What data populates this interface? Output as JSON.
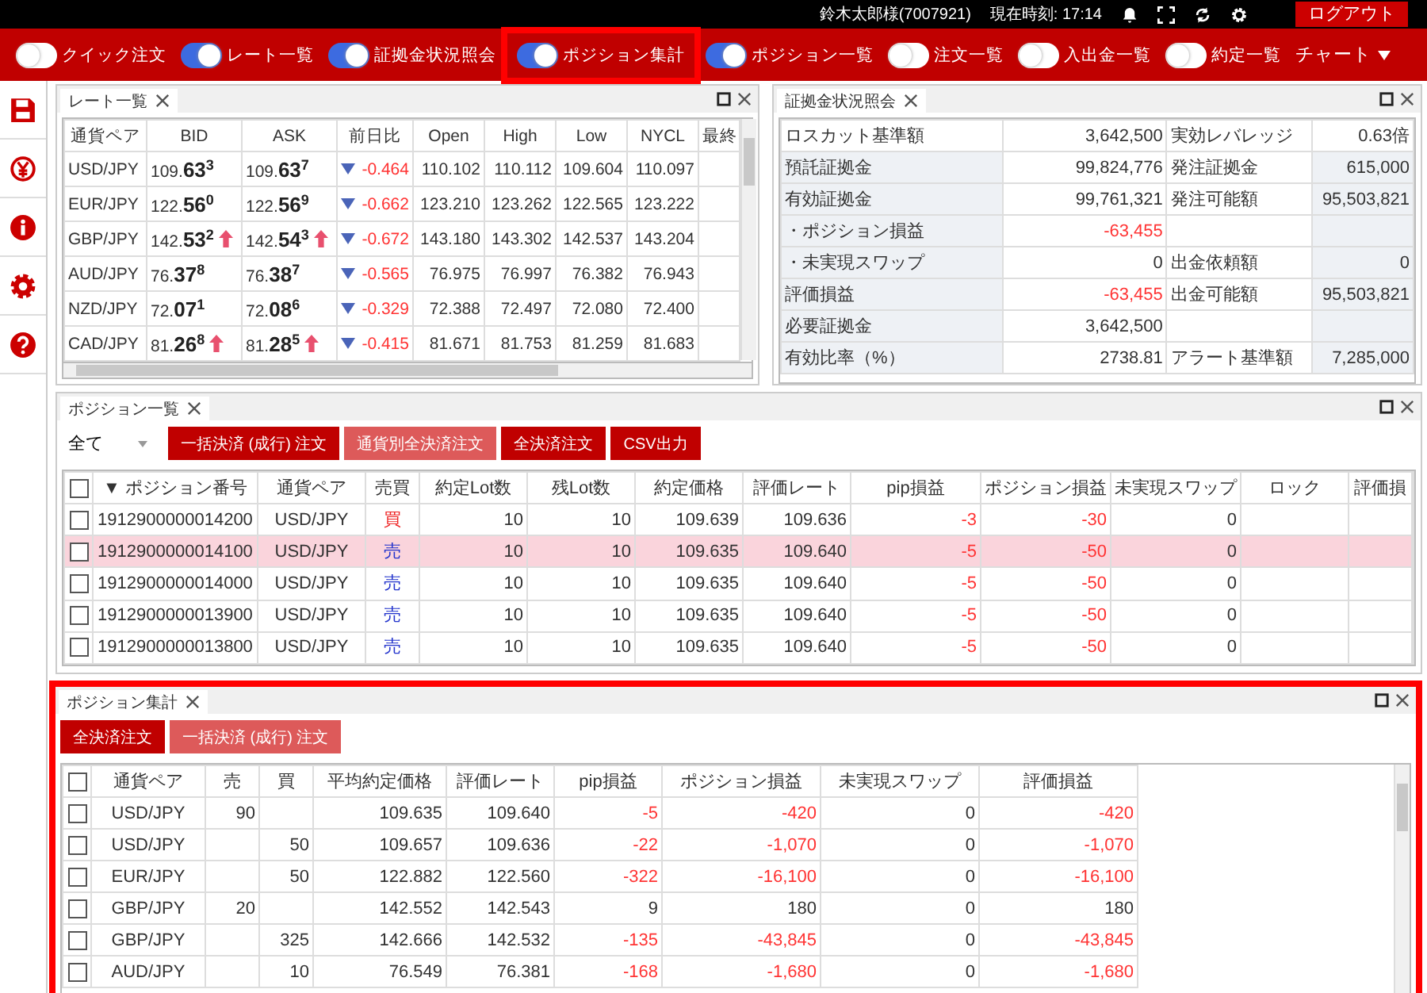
{
  "header": {
    "user": "鈴木太郎様(7007921)",
    "clock": "現在時刻: 17:14",
    "logout": "ログアウト"
  },
  "toolbar": {
    "toggles": [
      {
        "label": "クイック注文",
        "on": false,
        "highlighted": false
      },
      {
        "label": "レート一覧",
        "on": true,
        "highlighted": false
      },
      {
        "label": "証拠金状況照会",
        "on": true,
        "highlighted": false
      },
      {
        "label": "ポジション集計",
        "on": true,
        "highlighted": true
      },
      {
        "label": "ポジション一覧",
        "on": true,
        "highlighted": false
      },
      {
        "label": "注文一覧",
        "on": false,
        "highlighted": false
      },
      {
        "label": "入出金一覧",
        "on": false,
        "highlighted": false
      },
      {
        "label": "約定一覧",
        "on": false,
        "highlighted": false
      }
    ],
    "chart_menu": "チャート"
  },
  "rate_panel": {
    "tab": "レート一覧",
    "columns": [
      "通貨ペア",
      "BID",
      "ASK",
      "前日比",
      "Open",
      "High",
      "Low",
      "NYCL",
      "最終"
    ],
    "rows": [
      {
        "pair": "USD/JPY",
        "bid": "109.**63**$^{3}$",
        "bid_up": false,
        "ask": "109.**63**$^{7}$",
        "ask_up": false,
        "change": "-0.464",
        "change_down": true,
        "open": "110.102",
        "high": "110.112",
        "low": "109.604",
        "nycl": "110.097"
      },
      {
        "pair": "EUR/JPY",
        "bid": "122.**56**$^{0}$",
        "bid_up": false,
        "ask": "122.**56**$^{9}$",
        "ask_up": false,
        "change": "-0.662",
        "change_down": true,
        "open": "123.210",
        "high": "123.262",
        "low": "122.565",
        "nycl": "123.222"
      },
      {
        "pair": "GBP/JPY",
        "bid": "142.**53**$^{2}$",
        "bid_up": true,
        "ask": "142.**54**$^{3}$",
        "ask_up": true,
        "change": "-0.672",
        "change_down": true,
        "open": "143.180",
        "high": "143.302",
        "low": "142.537",
        "nycl": "143.204"
      },
      {
        "pair": "AUD/JPY",
        "bid": "76.**37**$^{8}$",
        "bid_up": false,
        "ask": "76.**38**$^{7}$",
        "ask_up": false,
        "change": "-0.565",
        "change_down": true,
        "open": "76.975",
        "high": "76.997",
        "low": "76.382",
        "nycl": "76.943"
      },
      {
        "pair": "NZD/JPY",
        "bid": "72.**07**$^{1}$",
        "bid_up": false,
        "ask": "72.**08**$^{6}$",
        "ask_up": false,
        "change": "-0.329",
        "change_down": true,
        "open": "72.388",
        "high": "72.497",
        "low": "72.080",
        "nycl": "72.400"
      },
      {
        "pair": "CAD/JPY",
        "bid": "81.**26**$^{8}$",
        "bid_up": true,
        "ask": "81.**28**$^{5}$",
        "ask_up": true,
        "change": "-0.415",
        "change_down": true,
        "open": "81.671",
        "high": "81.753",
        "low": "81.259",
        "nycl": "81.683"
      }
    ]
  },
  "margin_panel": {
    "tab": "証拠金状況照会",
    "rows": [
      {
        "label": "ロスカット基準額",
        "value": "3,642,500",
        "negative": false,
        "label_2": "実効レバレッジ",
        "value_2": "0.63倍"
      },
      {
        "label": "預託証拠金",
        "value": "99,824,776",
        "negative": false,
        "label_2": "発注証拠金",
        "value_2": "615,000"
      },
      {
        "label": "有効証拠金",
        "value": "99,761,321",
        "negative": false,
        "label_2": "発注可能額",
        "value_2": "95,503,821"
      },
      {
        "label": "・ポジション損益",
        "value": "-63,455",
        "negative": true
      },
      {
        "label": "・未実現スワップ",
        "value": "0",
        "negative": false,
        "label_2": "出金依頼額",
        "value_2": "0"
      },
      {
        "label": "評価損益",
        "value": "-63,455",
        "negative": true,
        "label_2": "出金可能額",
        "value_2": "95,503,821"
      },
      {
        "label": "必要証拠金",
        "value": "3,642,500",
        "negative": false
      },
      {
        "label": "有効比率（%）",
        "value": "2738.81",
        "negative": false,
        "label_2": "アラート基準額",
        "value_2": "7,285,000"
      }
    ]
  },
  "positions_panel": {
    "tab": "ポジション一覧",
    "filter": "全て",
    "buttons": [
      {
        "label": "一括決済 (成行) 注文",
        "disabled": false
      },
      {
        "label": "通貨別全決済注文",
        "disabled": true
      },
      {
        "label": "全決済注文",
        "disabled": false
      },
      {
        "label": "CSV出力",
        "disabled": false
      }
    ],
    "all_checked": false,
    "columns": [
      "▼ ポジション番号",
      "通貨ペア",
      "売買",
      "約定Lot数",
      "残Lot数",
      "約定価格",
      "評価レート",
      "pip損益",
      "ポジション損益",
      "未実現スワップ",
      "ロック",
      "評価損"
    ],
    "rows": [
      {
        "checked": false,
        "selected": false,
        "loss": true,
        "id": "1912900000014200",
        "pair": "USD/JPY",
        "side": "買",
        "color": "#ee2222",
        "lot": "10",
        "remaining": "10",
        "price": "109.639",
        "rate": "109.636",
        "pip": "-3",
        "pl": "-30",
        "swap": "0"
      },
      {
        "checked": false,
        "selected": true,
        "loss": true,
        "id": "1912900000014100",
        "pair": "USD/JPY",
        "side": "売",
        "color": "#2233cc",
        "lot": "10",
        "remaining": "10",
        "price": "109.635",
        "rate": "109.640",
        "pip": "-5",
        "pl": "-50",
        "swap": "0"
      },
      {
        "checked": false,
        "selected": false,
        "loss": true,
        "id": "1912900000014000",
        "pair": "USD/JPY",
        "side": "売",
        "color": "#2233cc",
        "lot": "10",
        "remaining": "10",
        "price": "109.635",
        "rate": "109.640",
        "pip": "-5",
        "pl": "-50",
        "swap": "0"
      },
      {
        "checked": false,
        "selected": false,
        "loss": true,
        "id": "1912900000013900",
        "pair": "USD/JPY",
        "side": "売",
        "color": "#2233cc",
        "lot": "10",
        "remaining": "10",
        "price": "109.635",
        "rate": "109.640",
        "pip": "-5",
        "pl": "-50",
        "swap": "0"
      },
      {
        "checked": false,
        "selected": false,
        "loss": true,
        "id": "1912900000013800",
        "pair": "USD/JPY",
        "side": "売",
        "color": "#2233cc",
        "lot": "10",
        "remaining": "10",
        "price": "109.635",
        "rate": "109.640",
        "pip": "-5",
        "pl": "-50",
        "swap": "0"
      }
    ]
  },
  "summary_panel": {
    "tab": "ポジション集計",
    "highlighted": true,
    "buttons": [
      {
        "label": "全決済注文",
        "disabled": false
      },
      {
        "label": "一括決済 (成行) 注文",
        "disabled": true
      }
    ],
    "all_checked": false,
    "columns": [
      "通貨ペア",
      "売",
      "買",
      "平均約定価格",
      "評価レート",
      "pip損益",
      "ポジション損益",
      "未実現スワップ",
      "評価損益"
    ],
    "rows": [
      {
        "checked": false,
        "loss": true,
        "pair": "USD/JPY",
        "sell": "90",
        "avg": "109.635",
        "rate": "109.640",
        "pip": "-5",
        "pl": "-420",
        "swap": "0",
        "eval": "-420"
      },
      {
        "checked": false,
        "loss": true,
        "pair": "USD/JPY",
        "buy": "50",
        "avg": "109.657",
        "rate": "109.636",
        "pip": "-22",
        "pl": "-1,070",
        "swap": "0",
        "eval": "-1,070"
      },
      {
        "checked": false,
        "loss": true,
        "pair": "EUR/JPY",
        "buy": "50",
        "avg": "122.882",
        "rate": "122.560",
        "pip": "-322",
        "pl": "-16,100",
        "swap": "0",
        "eval": "-16,100"
      },
      {
        "checked": false,
        "loss": false,
        "pair": "GBP/JPY",
        "sell": "20",
        "avg": "142.552",
        "rate": "142.543",
        "pip": "9",
        "pl": "180",
        "swap": "0",
        "eval": "180"
      },
      {
        "checked": false,
        "loss": true,
        "pair": "GBP/JPY",
        "buy": "325",
        "avg": "142.666",
        "rate": "142.532",
        "pip": "-135",
        "pl": "-43,845",
        "swap": "0",
        "eval": "-43,845"
      },
      {
        "checked": false,
        "loss": true,
        "pair": "AUD/JPY",
        "buy": "10",
        "avg": "76.549",
        "rate": "76.381",
        "pip": "-168",
        "pl": "-1,680",
        "swap": "0",
        "eval": "-1,680"
      }
    ]
  }
}
